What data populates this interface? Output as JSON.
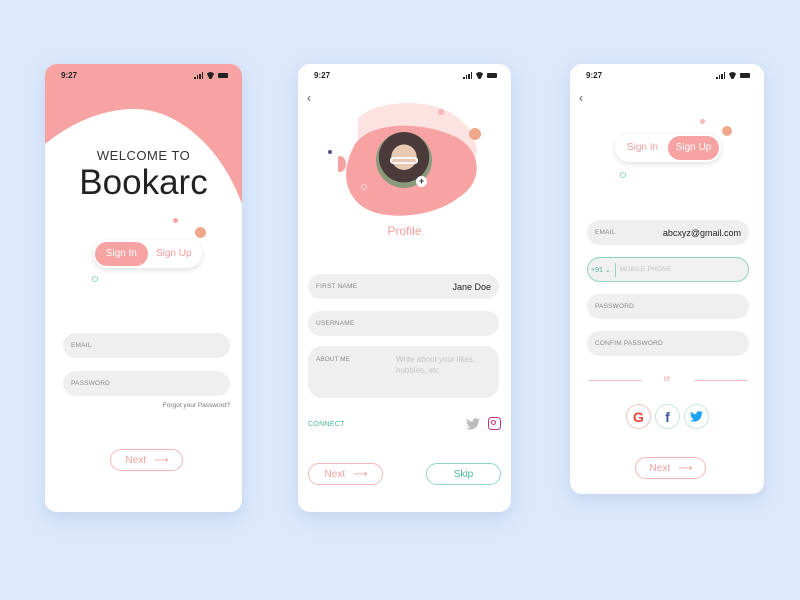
{
  "status": {
    "time": "9:27"
  },
  "colors": {
    "accent": "#f7a3a3",
    "teal": "#4bb89c",
    "background": "#dde9fb"
  },
  "screen1": {
    "welcome_small": "WELCOME TO",
    "app_name": "Bookarc",
    "toggle": {
      "sign_in": "Sign In",
      "sign_up": "Sign Up",
      "active": "Sign In"
    },
    "email_label": "EMAIL",
    "password_label": "PASSWORD",
    "forgot": "Forgot your Password?",
    "next": "Next",
    "arrow": "⟶"
  },
  "screen2": {
    "back": "‹",
    "avatar_add": "+",
    "title": "Profile",
    "first_name_label": "FIRST NAME",
    "first_name_value": "Jane Doe",
    "username_label": "USERNAME",
    "about_label": "ABOUT ME",
    "about_placeholder": "Write about your likes, hobbies, etc",
    "connect": "CONNECT",
    "next": "Next",
    "arrow": "⟶",
    "skip": "Skip"
  },
  "screen3": {
    "back": "‹",
    "toggle": {
      "sign_in": "Sign In",
      "sign_up": "Sign Up",
      "active": "Sign Up"
    },
    "email_label": "EMAIL",
    "email_value": "abcxyz@gmail.com",
    "country_code": "+91 ⌄",
    "mobile_placeholder": "MOBILE PHONE",
    "password_label": "PASSWORD",
    "confirm_label": "CONFIM PASSWORD",
    "or": "or",
    "google": "G",
    "facebook": "f",
    "next": "Next",
    "arrow": "⟶"
  }
}
